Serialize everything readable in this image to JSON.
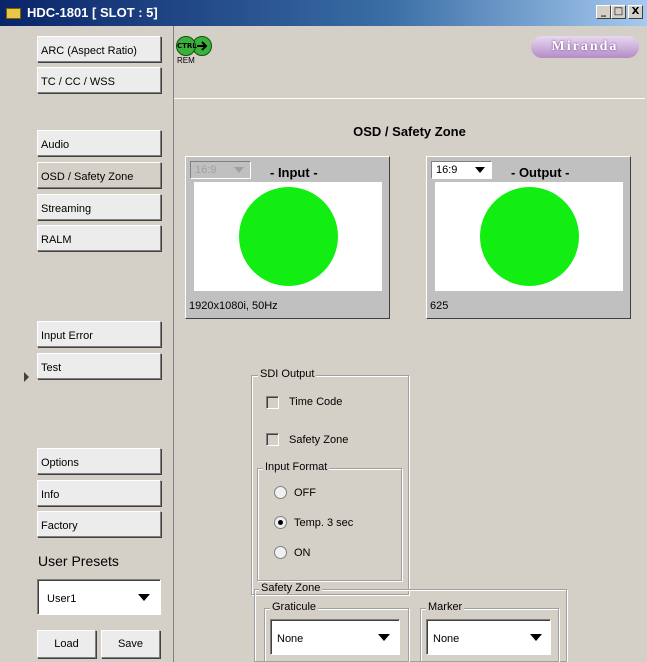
{
  "window": {
    "title": "HDC-1801 [ SLOT : 5]",
    "minimize": "_",
    "maximize": "□",
    "close": "X"
  },
  "sidebar": {
    "items": [
      {
        "label": "ARC (Aspect Ratio)"
      },
      {
        "label": "TC / CC / WSS"
      },
      {
        "label": "Audio"
      },
      {
        "label": "OSD / Safety Zone"
      },
      {
        "label": "Streaming"
      },
      {
        "label": "RALM"
      },
      {
        "label": "Input Error"
      },
      {
        "label": "Test"
      },
      {
        "label": "Options"
      },
      {
        "label": "Info"
      },
      {
        "label": "Factory"
      }
    ],
    "presets_label": "User Presets",
    "preset_value": "User1",
    "load_label": "Load",
    "save_label": "Save"
  },
  "header": {
    "ctrl_label": "CTRL",
    "rem_label": "REM",
    "logo_text": "Miranda"
  },
  "main": {
    "section_title": "OSD / Safety Zone",
    "input_panel": {
      "aspect": "16:9",
      "title": "- Input -",
      "resolution": "1920x1080i, 50Hz"
    },
    "output_panel": {
      "aspect": "16:9",
      "title": "- Output -",
      "resolution": "625"
    },
    "sdi_output": {
      "label": "SDI Output",
      "time_code": "Time Code",
      "safety_zone": "Safety Zone",
      "input_format": {
        "label": "Input Format",
        "options": [
          "OFF",
          "Temp. 3 sec",
          "ON"
        ],
        "selected": "Temp. 3 sec"
      }
    },
    "safety_zone": {
      "label": "Safety Zone",
      "graticule_label": "Graticule",
      "graticule_value": "None",
      "marker_label": "Marker",
      "marker_value": "None"
    }
  },
  "colors": {
    "title_bar": "#0a246a",
    "circle": "#12ee12",
    "panel_bg": "#d4d0c8"
  }
}
